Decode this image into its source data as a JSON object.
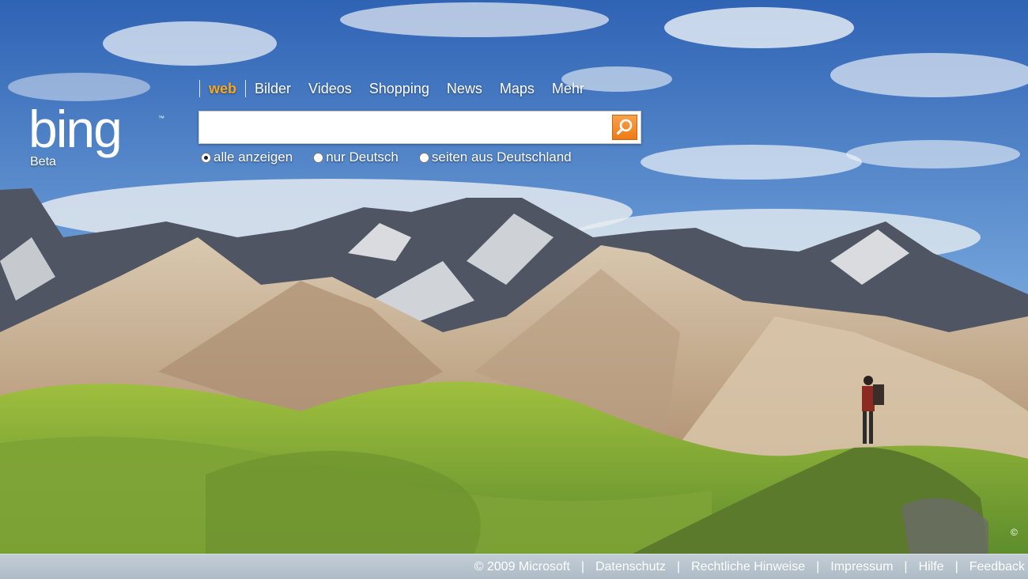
{
  "brand": {
    "logo_text": "bing",
    "badge": "Beta"
  },
  "nav": {
    "tabs": [
      {
        "label": "web",
        "active": true
      },
      {
        "label": "Bilder"
      },
      {
        "label": "Videos"
      },
      {
        "label": "Shopping"
      },
      {
        "label": "News"
      },
      {
        "label": "Maps"
      },
      {
        "label": "Mehr"
      }
    ]
  },
  "search": {
    "value": "",
    "placeholder": "",
    "button_icon": "magnifier-icon"
  },
  "scope": {
    "options": [
      {
        "label": "alle anzeigen",
        "selected": true
      },
      {
        "label": "nur Deutsch",
        "selected": false
      },
      {
        "label": "seiten aus Deutschland",
        "selected": false
      }
    ]
  },
  "image_copyright_symbol": "©",
  "footer": {
    "copyright": "© 2009 Microsoft",
    "links": [
      "Datenschutz",
      "Rechtliche Hinweise",
      "Impressum",
      "Hilfe",
      "Feedback"
    ],
    "separator": "|"
  },
  "colors": {
    "accent": "#f5a623",
    "search_button": "#ee7a16",
    "footer": "#b4c1cc"
  }
}
